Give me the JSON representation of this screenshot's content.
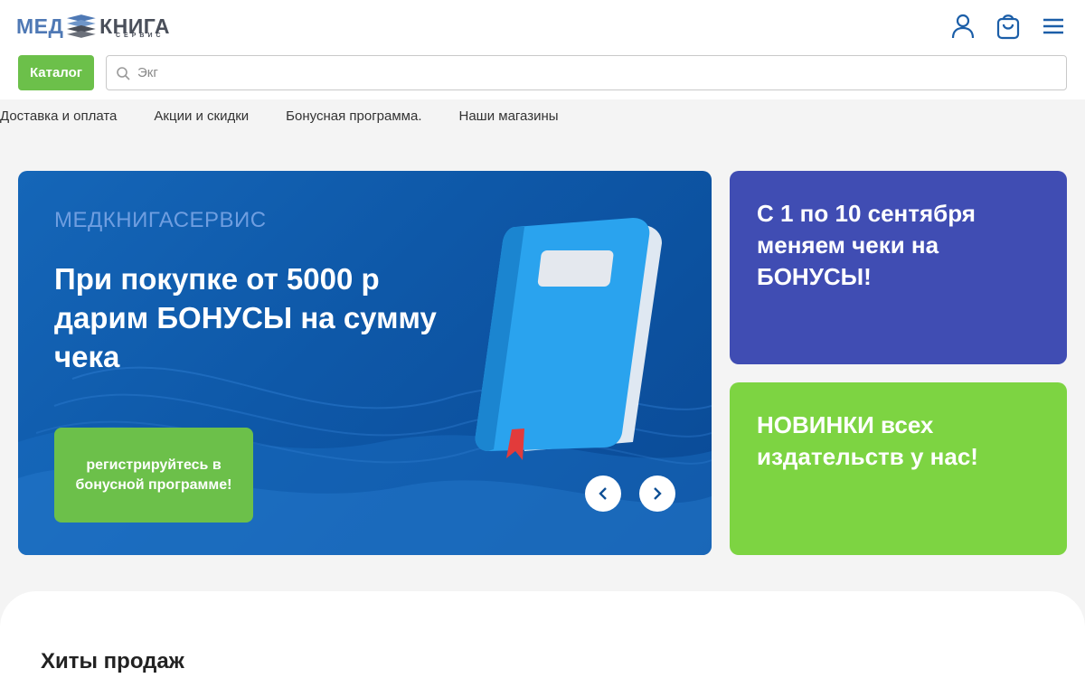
{
  "logo": {
    "part1": "МЕД",
    "part2": "КНИГА",
    "sub": "СЕРВИС"
  },
  "header": {
    "icons": [
      "user-icon",
      "cart-icon",
      "menu-icon"
    ]
  },
  "catalog_label": "Каталог",
  "search": {
    "placeholder": "Экг",
    "value": ""
  },
  "nav": [
    "Доставка и оплата",
    "Акции и скидки",
    "Бонусная программа.",
    "Наши магазины"
  ],
  "banner": {
    "brand": "МЕДКНИГАСЕРВИС",
    "title": "При покупке от 5000 р дарим БОНУСЫ на сумму чека",
    "cta": "регистрируйтесь в бонусной программе!"
  },
  "cards": {
    "purple": "С 1 по 10 сентября меняем чеки на БОНУСЫ!",
    "green": "НОВИНКИ всех издательств у нас!"
  },
  "hits_title": "Хиты продаж",
  "colors": {
    "accent_green": "#6cc04a",
    "banner_blue": "#0e58a8",
    "card_purple": "#404db3",
    "card_green": "#7dd442",
    "icon_blue": "#1b5ea8"
  }
}
